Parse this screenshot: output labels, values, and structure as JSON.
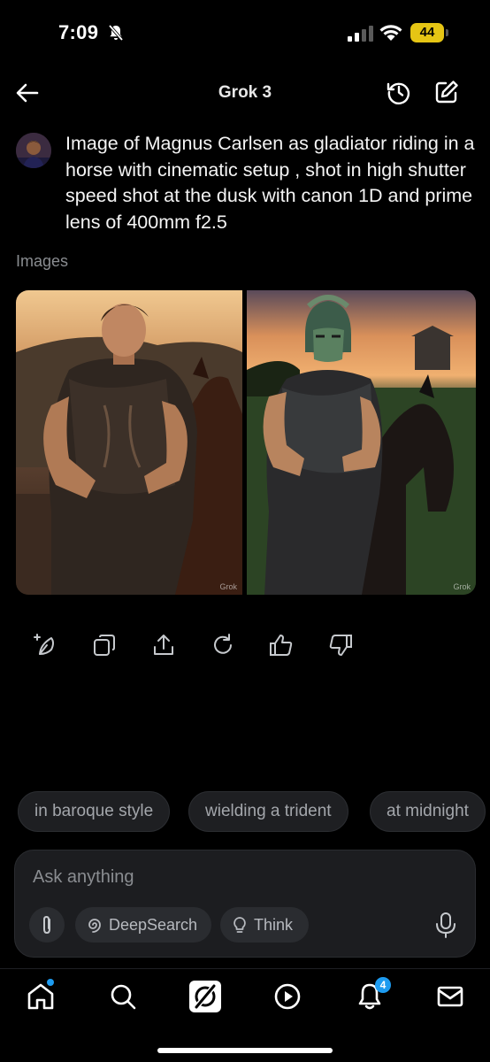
{
  "status_bar": {
    "time": "7:09",
    "battery": "44"
  },
  "header": {
    "title": "Grok 3"
  },
  "conversation": {
    "prompt": "Image of Magnus Carlsen as gladiator riding in a horse with cinematic setup , shot in high shutter speed shot at the dusk with canon 1D and prime lens of 400mm f2.5",
    "images_label": "Images",
    "watermark": "Grok"
  },
  "suggestions": [
    "in baroque style",
    "wielding a trident",
    "at midnight"
  ],
  "composer": {
    "placeholder": "Ask anything",
    "deepsearch_label": "DeepSearch",
    "think_label": "Think"
  },
  "bottom_nav": {
    "notification_count": "4"
  },
  "icons": {
    "back": "arrow-left-icon",
    "history": "history-icon",
    "edit": "edit-icon",
    "actions": [
      "edit-image-icon",
      "copy-icon",
      "share-icon",
      "regenerate-icon",
      "thumbs-up-icon",
      "thumbs-down-icon"
    ],
    "nav": [
      "home-icon",
      "search-icon",
      "grok-icon",
      "play-icon",
      "bell-icon",
      "mail-icon"
    ]
  },
  "colors": {
    "background": "#000000",
    "accent": "#1d9bf0",
    "battery": "#e6c514"
  }
}
